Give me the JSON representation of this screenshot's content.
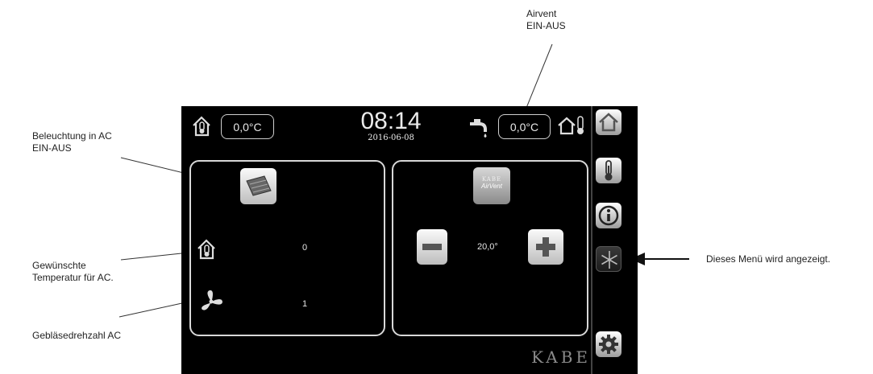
{
  "annotations": {
    "lighting": "Beleuchtung in AC\nEIN-AUS",
    "airvent": "Airvent\nEIN-AUS",
    "desired_temp": "Gewünschte\nTemperatur für AC.",
    "fan_speed": "Gebläsedrehzahl AC",
    "menu_shown": "Dieses Menü wird angezeigt."
  },
  "header": {
    "indoor_temp": "0,0°C",
    "time": "08:14",
    "date": "2016-06-08",
    "outdoor_temp": "0,0°C"
  },
  "left_panel": {
    "desired_temp_value": "0",
    "fan_speed_value": "1"
  },
  "right_panel": {
    "airvent_logo_top": "KABE",
    "airvent_logo_bottom": "AirVent",
    "setpoint": "20,0°"
  },
  "brand": "KABE",
  "sidebar": {
    "items": [
      "home-icon",
      "thermometer-icon",
      "info-icon",
      "snowflake-icon",
      "gear-icon"
    ],
    "active": "snowflake-icon"
  }
}
